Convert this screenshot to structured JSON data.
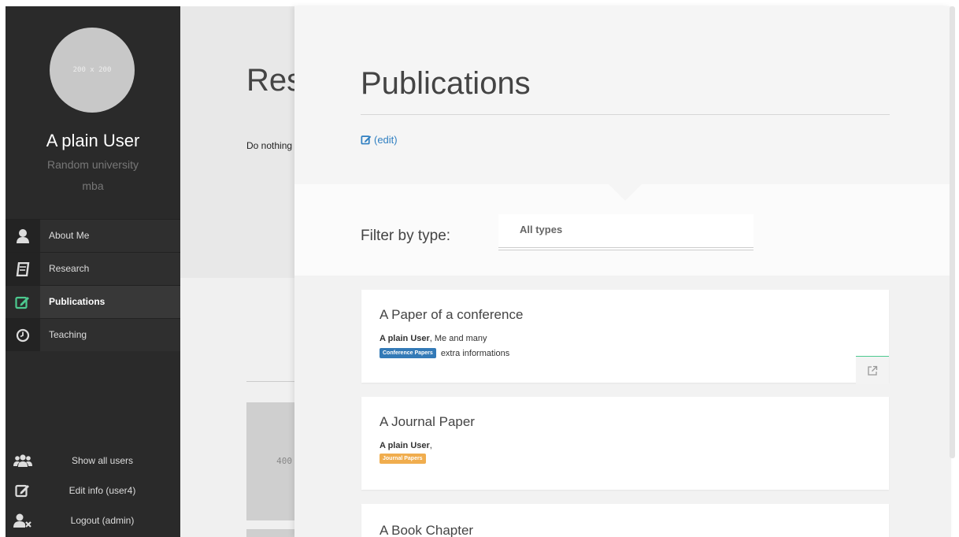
{
  "sidebar": {
    "avatar_placeholder": "200 x 200",
    "user_name": "A plain User",
    "university": "Random university",
    "degree": "mba",
    "nav": [
      {
        "label": "About Me",
        "icon": "user-icon"
      },
      {
        "label": "Research",
        "icon": "book-icon"
      },
      {
        "label": "Publications",
        "icon": "edit-icon",
        "active": true
      },
      {
        "label": "Teaching",
        "icon": "clock-icon"
      }
    ],
    "bottom": [
      {
        "label": "Show all users",
        "icon": "users-icon"
      },
      {
        "label": "Edit info (user4)",
        "icon": "edit-icon"
      },
      {
        "label": "Logout (admin)",
        "icon": "user-remove-icon"
      }
    ]
  },
  "background_page": {
    "title": "Research",
    "subtitle": "Do nothing",
    "image_placeholder": "400"
  },
  "publications": {
    "title": "Publications",
    "edit_label": "(edit)",
    "filter_label": "Filter by type:",
    "filter_value": "All types",
    "cards": [
      {
        "title": "A Paper of a conference",
        "author_bold": "A plain User",
        "author_rest": ", Me and many",
        "badge": "Conference Papers",
        "extra": "extra informations"
      },
      {
        "title": "A Journal Paper",
        "author_bold": "A plain User",
        "author_rest": ",",
        "badge": "Journal Papers",
        "extra": ""
      },
      {
        "title": "A Book Chapter"
      }
    ]
  },
  "colors": {
    "accent_green": "#4cc98f",
    "link_blue": "#2f7fc1",
    "badge_blue": "#337ab7",
    "badge_orange": "#f0ad4e"
  }
}
